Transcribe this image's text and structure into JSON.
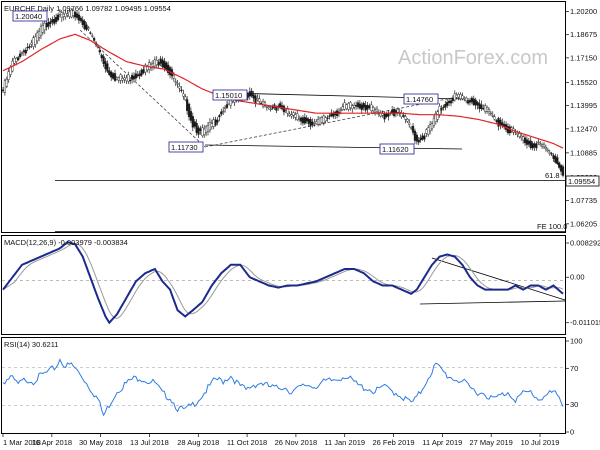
{
  "chart_data": [
    {
      "type": "candlestick",
      "title": "EURCHF Daily",
      "ohlc_readout": [
        "1.09766",
        "1.09782",
        "1.09495",
        "1.09554"
      ],
      "watermark": "ActionForex.com",
      "x_tick_labels": [
        "1 Mar 2018",
        "16 Apr 2018",
        "30 May 2018",
        "13 Jul 2018",
        "28 Aug 2018",
        "11 Oct 2018",
        "26 Nov 2018",
        "11 Jan 2019",
        "26 Feb 2019",
        "11 Apr 2019",
        "27 May 2019",
        "10 Jul 2019"
      ],
      "y_ticks": [
        "1.20200",
        "1.18675",
        "1.17150",
        "1.15520",
        "1.13995",
        "1.12470",
        "1.10885",
        "1.09260",
        "1.07735",
        "1.06205"
      ],
      "ylim": [
        1.058,
        1.207
      ],
      "last_price_label": "1.09554",
      "fib_labels": [
        "61.8",
        "FE 100.0"
      ],
      "level_labels": [
        "1.20040",
        "1.15010",
        "1.14760",
        "1.11730",
        "1.11620"
      ],
      "close_points": [
        [
          0,
          1.15
        ],
        [
          5,
          1.168
        ],
        [
          10,
          1.175
        ],
        [
          15,
          1.18
        ],
        [
          20,
          1.19
        ],
        [
          25,
          1.196
        ],
        [
          30,
          1.199
        ],
        [
          35,
          1.2
        ],
        [
          38,
          1.2
        ],
        [
          42,
          1.195
        ],
        [
          46,
          1.187
        ],
        [
          50,
          1.178
        ],
        [
          55,
          1.163
        ],
        [
          60,
          1.158
        ],
        [
          65,
          1.158
        ],
        [
          70,
          1.16
        ],
        [
          75,
          1.165
        ],
        [
          80,
          1.168
        ],
        [
          83,
          1.17
        ],
        [
          88,
          1.162
        ],
        [
          92,
          1.153
        ],
        [
          96,
          1.143
        ],
        [
          100,
          1.128
        ],
        [
          104,
          1.122
        ],
        [
          108,
          1.125
        ],
        [
          112,
          1.13
        ],
        [
          116,
          1.138
        ],
        [
          120,
          1.143
        ],
        [
          125,
          1.146
        ],
        [
          130,
          1.148
        ],
        [
          135,
          1.142
        ],
        [
          140,
          1.138
        ],
        [
          145,
          1.14
        ],
        [
          150,
          1.135
        ],
        [
          155,
          1.132
        ],
        [
          160,
          1.13
        ],
        [
          165,
          1.128
        ],
        [
          170,
          1.132
        ],
        [
          175,
          1.135
        ],
        [
          180,
          1.139
        ],
        [
          185,
          1.14
        ],
        [
          190,
          1.14
        ],
        [
          195,
          1.137
        ],
        [
          200,
          1.133
        ],
        [
          205,
          1.136
        ],
        [
          210,
          1.134
        ],
        [
          215,
          1.125
        ],
        [
          218,
          1.117
        ],
        [
          222,
          1.12
        ],
        [
          226,
          1.128
        ],
        [
          230,
          1.137
        ],
        [
          234,
          1.142
        ],
        [
          238,
          1.146
        ],
        [
          242,
          1.145
        ],
        [
          246,
          1.143
        ],
        [
          250,
          1.141
        ],
        [
          254,
          1.137
        ],
        [
          258,
          1.133
        ],
        [
          262,
          1.128
        ],
        [
          266,
          1.125
        ],
        [
          270,
          1.122
        ],
        [
          274,
          1.118
        ],
        [
          278,
          1.114
        ],
        [
          282,
          1.115
        ],
        [
          286,
          1.111
        ],
        [
          290,
          1.106
        ],
        [
          295,
          1.096
        ]
      ],
      "ma_points": [
        [
          0,
          1.163
        ],
        [
          10,
          1.169
        ],
        [
          20,
          1.177
        ],
        [
          30,
          1.184
        ],
        [
          38,
          1.187
        ],
        [
          46,
          1.183
        ],
        [
          55,
          1.176
        ],
        [
          65,
          1.169
        ],
        [
          75,
          1.166
        ],
        [
          85,
          1.164
        ],
        [
          95,
          1.158
        ],
        [
          105,
          1.151
        ],
        [
          115,
          1.146
        ],
        [
          125,
          1.143
        ],
        [
          135,
          1.141
        ],
        [
          150,
          1.138
        ],
        [
          165,
          1.135
        ],
        [
          180,
          1.135
        ],
        [
          195,
          1.135
        ],
        [
          210,
          1.135
        ],
        [
          220,
          1.134
        ],
        [
          230,
          1.134
        ],
        [
          240,
          1.133
        ],
        [
          250,
          1.131
        ],
        [
          260,
          1.128
        ],
        [
          270,
          1.123
        ],
        [
          280,
          1.119
        ],
        [
          290,
          1.115
        ],
        [
          295,
          1.112
        ]
      ]
    },
    {
      "type": "line",
      "title": "MACD(12,26,9) -0.003979 -0.003834",
      "ylim": [
        -0.0135,
        0.0095
      ],
      "y_ticks": [
        "0.008292",
        "0.00",
        "-0.011015"
      ],
      "zero_label": "0.00",
      "macd_points": [
        [
          0,
          -0.003
        ],
        [
          5,
          0.0
        ],
        [
          10,
          0.003
        ],
        [
          15,
          0.004
        ],
        [
          20,
          0.005
        ],
        [
          25,
          0.006
        ],
        [
          30,
          0.007
        ],
        [
          34,
          0.0085
        ],
        [
          38,
          0.008
        ],
        [
          42,
          0.005
        ],
        [
          46,
          0.0
        ],
        [
          50,
          -0.005
        ],
        [
          54,
          -0.0095
        ],
        [
          56,
          -0.011
        ],
        [
          60,
          -0.009
        ],
        [
          65,
          -0.005
        ],
        [
          70,
          -0.001
        ],
        [
          75,
          0.001
        ],
        [
          80,
          0.002
        ],
        [
          84,
          -0.001
        ],
        [
          88,
          -0.003
        ],
        [
          92,
          -0.008
        ],
        [
          96,
          -0.0095
        ],
        [
          100,
          -0.008
        ],
        [
          105,
          -0.006
        ],
        [
          110,
          -0.002
        ],
        [
          115,
          0.001
        ],
        [
          120,
          0.003
        ],
        [
          125,
          0.003
        ],
        [
          130,
          0.0
        ],
        [
          135,
          -0.001
        ],
        [
          140,
          -0.002
        ],
        [
          145,
          -0.0025
        ],
        [
          150,
          -0.002
        ],
        [
          155,
          -0.002
        ],
        [
          160,
          -0.0015
        ],
        [
          165,
          -0.001
        ],
        [
          170,
          0.0
        ],
        [
          175,
          0.001
        ],
        [
          180,
          0.002
        ],
        [
          185,
          0.002
        ],
        [
          190,
          0.001
        ],
        [
          195,
          -0.001
        ],
        [
          200,
          -0.002
        ],
        [
          205,
          -0.002
        ],
        [
          210,
          -0.003
        ],
        [
          215,
          -0.004
        ],
        [
          218,
          -0.003
        ],
        [
          222,
          0.0
        ],
        [
          226,
          0.003
        ],
        [
          230,
          0.005
        ],
        [
          234,
          0.0055
        ],
        [
          238,
          0.005
        ],
        [
          242,
          0.003
        ],
        [
          246,
          0.0
        ],
        [
          250,
          -0.002
        ],
        [
          254,
          -0.003
        ],
        [
          258,
          -0.003
        ],
        [
          262,
          -0.003
        ],
        [
          266,
          -0.003
        ],
        [
          270,
          -0.002
        ],
        [
          274,
          -0.003
        ],
        [
          278,
          -0.002
        ],
        [
          282,
          -0.002
        ],
        [
          286,
          -0.003
        ],
        [
          290,
          -0.002
        ],
        [
          295,
          -0.004
        ]
      ],
      "signal_offset": 3
    },
    {
      "type": "line",
      "title": "RSI(14) 30.6211",
      "ylim": [
        0,
        100
      ],
      "y_ticks": [
        "100",
        "70",
        "30",
        "0"
      ],
      "rsi_points": [
        [
          0,
          55
        ],
        [
          4,
          60
        ],
        [
          8,
          52
        ],
        [
          12,
          58
        ],
        [
          16,
          56
        ],
        [
          20,
          62
        ],
        [
          24,
          66
        ],
        [
          28,
          72
        ],
        [
          30,
          80
        ],
        [
          33,
          72
        ],
        [
          36,
          74
        ],
        [
          38,
          70
        ],
        [
          42,
          60
        ],
        [
          46,
          48
        ],
        [
          50,
          36
        ],
        [
          53,
          18
        ],
        [
          56,
          30
        ],
        [
          60,
          45
        ],
        [
          64,
          52
        ],
        [
          68,
          58
        ],
        [
          72,
          60
        ],
        [
          76,
          56
        ],
        [
          80,
          54
        ],
        [
          84,
          42
        ],
        [
          88,
          38
        ],
        [
          92,
          26
        ],
        [
          96,
          24
        ],
        [
          100,
          30
        ],
        [
          104,
          38
        ],
        [
          108,
          48
        ],
        [
          112,
          58
        ],
        [
          116,
          56
        ],
        [
          120,
          62
        ],
        [
          124,
          52
        ],
        [
          128,
          46
        ],
        [
          132,
          52
        ],
        [
          136,
          54
        ],
        [
          140,
          50
        ],
        [
          144,
          48
        ],
        [
          148,
          50
        ],
        [
          152,
          44
        ],
        [
          156,
          48
        ],
        [
          160,
          52
        ],
        [
          164,
          50
        ],
        [
          168,
          54
        ],
        [
          172,
          56
        ],
        [
          176,
          58
        ],
        [
          180,
          62
        ],
        [
          184,
          56
        ],
        [
          188,
          50
        ],
        [
          192,
          48
        ],
        [
          196,
          44
        ],
        [
          200,
          50
        ],
        [
          204,
          46
        ],
        [
          208,
          42
        ],
        [
          212,
          36
        ],
        [
          216,
          32
        ],
        [
          220,
          44
        ],
        [
          224,
          60
        ],
        [
          228,
          74
        ],
        [
          231,
          68
        ],
        [
          234,
          62
        ],
        [
          238,
          58
        ],
        [
          242,
          56
        ],
        [
          246,
          48
        ],
        [
          250,
          44
        ],
        [
          254,
          42
        ],
        [
          258,
          36
        ],
        [
          262,
          40
        ],
        [
          266,
          44
        ],
        [
          270,
          36
        ],
        [
          274,
          42
        ],
        [
          278,
          44
        ],
        [
          282,
          36
        ],
        [
          286,
          40
        ],
        [
          290,
          44
        ],
        [
          295,
          31
        ]
      ]
    }
  ]
}
